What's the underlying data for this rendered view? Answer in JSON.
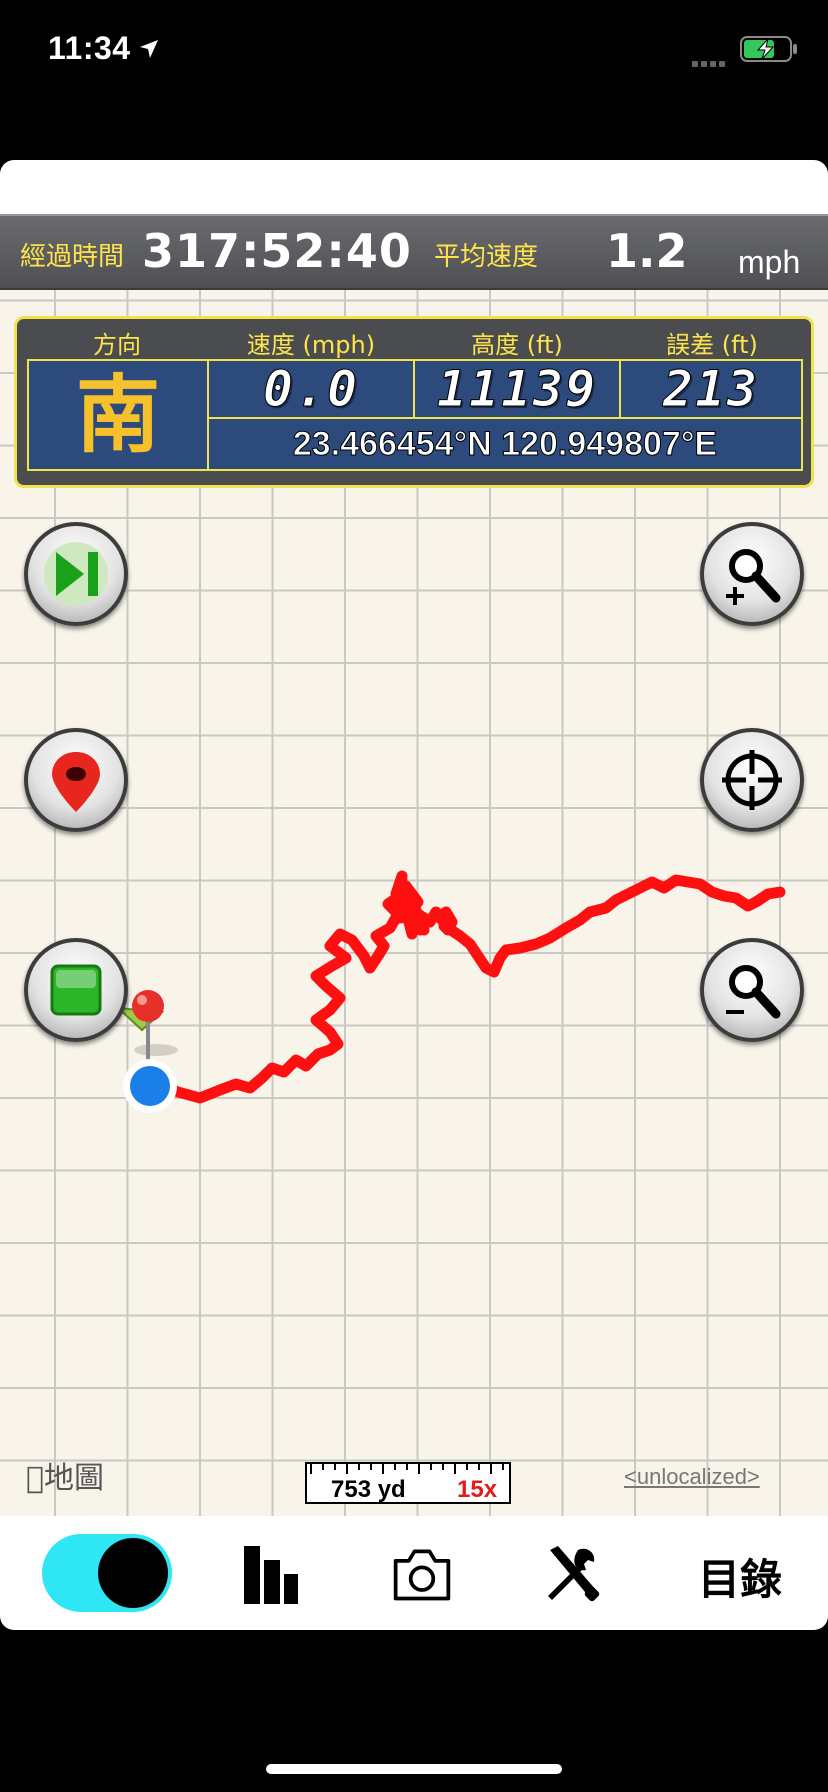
{
  "status_bar": {
    "time": "11:34"
  },
  "info_bar": {
    "elapsed_label": "經過時間",
    "elapsed_value": "317:52:40",
    "avg_speed_label": "平均速度",
    "avg_speed_value": "1.2",
    "avg_speed_unit": "mph"
  },
  "panel": {
    "headers": {
      "direction": "方向",
      "speed": "速度 (mph)",
      "altitude": "高度 (ft)",
      "error": "誤差 (ft)"
    },
    "direction": "南",
    "speed": "0.0",
    "altitude": "11139",
    "error": "213",
    "coordinates": "23.466454°N 120.949807°E"
  },
  "map": {
    "attribution": "地圖",
    "scale_distance": "753 yd",
    "scale_zoom": "15x",
    "unlocalized_link": "<unlocalized>",
    "track_color": "#ff1010",
    "grid_color": "#c8c8c4",
    "background_color": "#f8f4ea"
  },
  "buttons": {
    "left": [
      "play-next-icon",
      "map-pin-icon",
      "stop-icon"
    ],
    "right": [
      "zoom-in-icon",
      "locate-crosshair-icon",
      "zoom-out-icon"
    ]
  },
  "toolbar": {
    "toggle_state": "on",
    "toggle_color": "#2ee6f4",
    "items": [
      "stats-icon",
      "camera-icon",
      "tools-icon"
    ],
    "list_label": "目錄"
  }
}
